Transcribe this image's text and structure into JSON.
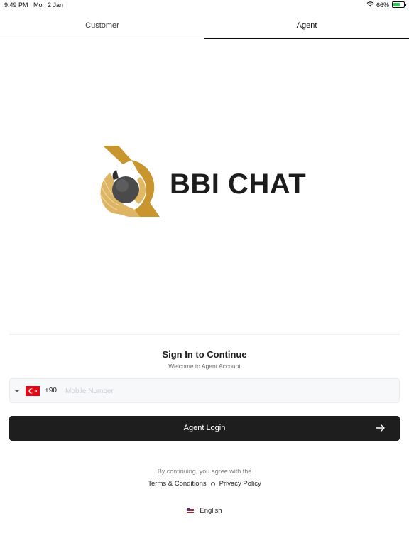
{
  "status_bar": {
    "time": "9:49 PM",
    "date": "Mon 2 Jan",
    "battery": "66%",
    "battery_level": 0.66,
    "icons": [
      "wifi-icon",
      "battery-icon"
    ]
  },
  "tabs": [
    {
      "label": "Customer",
      "active": false
    },
    {
      "label": "Agent",
      "active": true
    }
  ],
  "logo": {
    "text": "BBI CHAT",
    "colors": {
      "gold": "#c9952e",
      "dark": "#1c1c1c"
    }
  },
  "form": {
    "heading": "Sign In to Continue",
    "subheading": "Welcome to Agent Account",
    "country_flag": "turkey-flag-icon",
    "dial_code": "+90",
    "phone_value": "",
    "phone_placeholder": "Mobile Number",
    "login_label": "Agent Login"
  },
  "footer": {
    "agree_text": "By continuing, you agree with the",
    "terms_label": "Terms & Conditions",
    "privacy_label": "Privacy Policy",
    "language_label": "English",
    "language_flag": "us-flag-icon"
  },
  "colors": {
    "accent": "#1e1e1e",
    "field_bg": "#f7f8fa",
    "battery_green": "#34c759"
  }
}
